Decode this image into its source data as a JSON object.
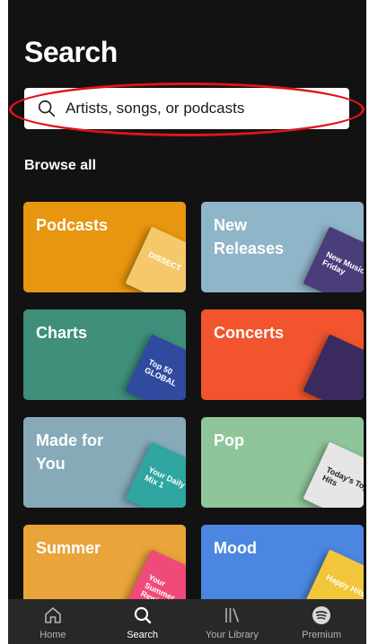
{
  "header": {
    "title": "Search"
  },
  "search": {
    "placeholder": "Artists, songs, or podcasts",
    "icon": "search-icon"
  },
  "section": {
    "title": "Browse all"
  },
  "tiles": [
    {
      "label": "Podcasts",
      "color": "#e8950f",
      "art_color": "#f5c96b",
      "art_text": "DISSECT"
    },
    {
      "label": "New Releases",
      "color": "#8fb5c8",
      "art_color": "#4a3d7a",
      "art_text": "New Music Friday"
    },
    {
      "label": "Charts",
      "color": "#3f8f7a",
      "art_color": "#2f4a9e",
      "art_text": "Top 50 GLOBAL"
    },
    {
      "label": "Concerts",
      "color": "#f2542d",
      "art_color": "#3b2a5e",
      "art_text": ""
    },
    {
      "label": "Made for You",
      "color": "#86aab8",
      "art_color": "#2fa6a0",
      "art_text": "Your Daily Mix 1"
    },
    {
      "label": "Pop",
      "color": "#8fc59a",
      "art_color": "#e6e6e6",
      "art_text": "Today's Top Hits"
    },
    {
      "label": "Summer",
      "color": "#e9a43a",
      "art_color": "#f04a7a",
      "art_text": "Your Summer Rewind"
    },
    {
      "label": "Mood",
      "color": "#4b87e0",
      "art_color": "#f2c63a",
      "art_text": "Happy Hits"
    }
  ],
  "nav": [
    {
      "label": "Home",
      "icon": "home-icon"
    },
    {
      "label": "Search",
      "icon": "search-icon",
      "active": true
    },
    {
      "label": "Your Library",
      "icon": "library-icon"
    },
    {
      "label": "Premium",
      "icon": "spotify-icon"
    }
  ],
  "colors": {
    "background": "#121212",
    "nav_background": "#282828",
    "highlight": "#e0141a"
  }
}
